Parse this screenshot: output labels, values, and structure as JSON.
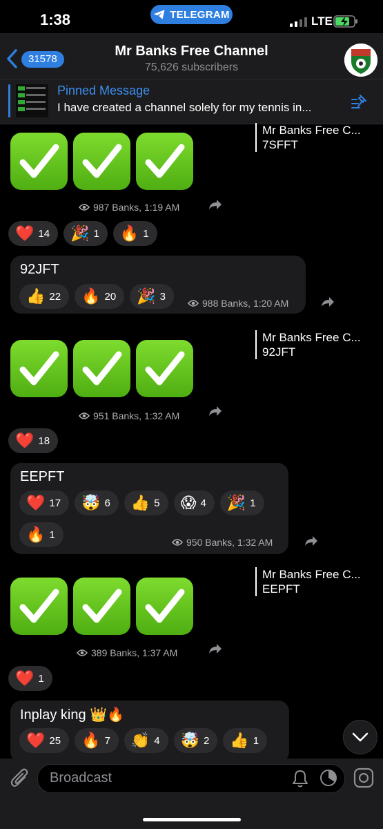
{
  "status_bar": {
    "time": "1:38",
    "pill": "TELEGRAM",
    "network": "LTE"
  },
  "header": {
    "back_count": "31578",
    "title": "Mr Banks Free Channel",
    "subtitle": "75,626 subscribers"
  },
  "pinned": {
    "title": "Pinned Message",
    "text": "I have created a channel solely for my tennis in..."
  },
  "messages": {
    "m1": {
      "forward_name": "Mr Banks Free C...",
      "forward_text": "7SFFT",
      "meta": "987 Banks, 1:19 AM",
      "reactions": [
        {
          "emoji": "❤️",
          "count": "14"
        },
        {
          "emoji": "🎉",
          "count": "1"
        },
        {
          "emoji": "🔥",
          "count": "1"
        }
      ]
    },
    "m2": {
      "text": "92JFT",
      "meta": "988 Banks, 1:20 AM",
      "reactions": [
        {
          "emoji": "👍",
          "count": "22"
        },
        {
          "emoji": "🔥",
          "count": "20"
        },
        {
          "emoji": "🎉",
          "count": "3"
        }
      ]
    },
    "m3": {
      "forward_name": "Mr Banks Free C...",
      "forward_text": "92JFT",
      "meta": "951 Banks, 1:32 AM",
      "reactions": [
        {
          "emoji": "❤️",
          "count": "18"
        }
      ]
    },
    "m4": {
      "text": "EEPFT",
      "meta": "950 Banks, 1:32 AM",
      "reactions": [
        {
          "emoji": "❤️",
          "count": "17"
        },
        {
          "emoji": "🤯",
          "count": "6"
        },
        {
          "emoji": "👍",
          "count": "5"
        },
        {
          "emoji": "😱",
          "count": "4"
        },
        {
          "emoji": "🎉",
          "count": "1"
        },
        {
          "emoji": "🔥",
          "count": "1"
        }
      ]
    },
    "m5": {
      "forward_name": "Mr Banks Free C...",
      "forward_text": "EEPFT",
      "meta": "389 Banks, 1:37 AM",
      "reactions": [
        {
          "emoji": "❤️",
          "count": "1"
        }
      ]
    },
    "m6": {
      "text": "Inplay king 👑🔥",
      "reactions": [
        {
          "emoji": "❤️",
          "count": "25"
        },
        {
          "emoji": "🔥",
          "count": "7"
        },
        {
          "emoji": "👏",
          "count": "4"
        },
        {
          "emoji": "🤯",
          "count": "2"
        },
        {
          "emoji": "👍",
          "count": "1"
        }
      ]
    }
  },
  "input": {
    "placeholder": "Broadcast"
  },
  "colors": {
    "accent": "#2f7fe0",
    "bubble": "#1c1c1e",
    "check_green": "#5cc51c"
  }
}
